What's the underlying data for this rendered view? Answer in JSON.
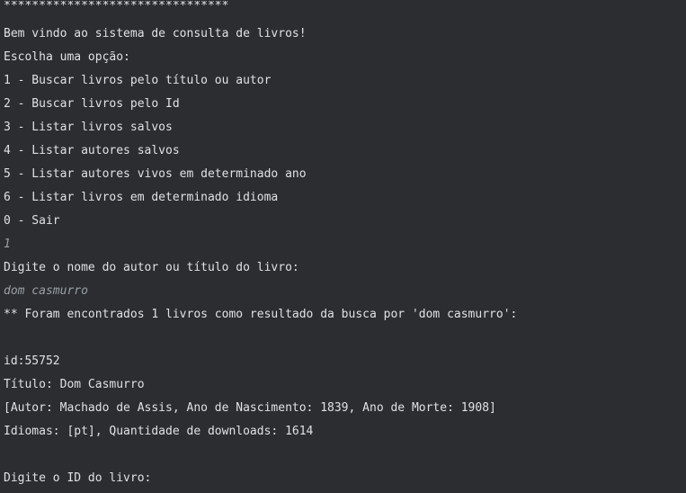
{
  "console": {
    "lines": [
      "********************************",
      "Bem vindo ao sistema de consulta de livros!",
      "Escolha uma opção:",
      "1 - Buscar livros pelo título ou autor",
      "2 - Buscar livros pelo Id",
      "3 - Listar livros salvos",
      "4 - Listar autores salvos",
      "5 - Listar autores vivos em determinado ano",
      "6 - Listar livros em determinado idioma",
      "0 - Sair",
      "1",
      "Digite o nome do autor ou título do livro:",
      "dom casmurro",
      "** Foram encontrados 1 livros como resultado da busca por 'dom casmurro':",
      "",
      "id:55752",
      "Título: Dom Casmurro",
      "[Autor: Machado de Assis, Ano de Nascimento: 1839, Ano de Morte: 1908]",
      "Idiomas: [pt], Quantidade de downloads: 1614",
      "",
      "Digite o ID do livro:"
    ]
  }
}
